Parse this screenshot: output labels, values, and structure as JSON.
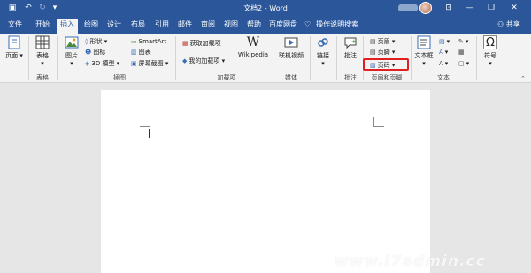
{
  "window": {
    "title": "文档2 - Word",
    "share_label": "共享"
  },
  "tabs": [
    "文件",
    "开始",
    "插入",
    "绘图",
    "设计",
    "布局",
    "引用",
    "邮件",
    "审阅",
    "视图",
    "帮助",
    "百度网盘"
  ],
  "active_tab": "插入",
  "tell_me": "操作说明搜索",
  "ribbon": {
    "pages": {
      "btn": "页面"
    },
    "tables": {
      "btn": "表格",
      "group": "表格"
    },
    "illustrations": {
      "group": "插图",
      "picture": "图片",
      "shapes": "形状",
      "icons": "图标",
      "model3d": "3D 模型",
      "smartart": "SmartArt",
      "chart": "图表",
      "screenshot": "屏幕截图"
    },
    "addins": {
      "group": "加载项",
      "get": "获取加载项",
      "my": "我的加载项",
      "wikipedia": "Wikipedia",
      "wiki_glyph": "W"
    },
    "media": {
      "group": "媒体",
      "video": "联机视频"
    },
    "links": {
      "btn": "链接"
    },
    "comments": {
      "group": "批注",
      "btn": "批注"
    },
    "header_footer": {
      "group": "页眉和页脚",
      "header": "页眉",
      "footer": "页脚",
      "page_number": "页码"
    },
    "text": {
      "group": "文本",
      "textbox": "文本框"
    },
    "symbols": {
      "btn": "符号",
      "omega": "Ω"
    }
  },
  "watermark": "www.I7admin.cc",
  "colors": {
    "accent": "#2b579a",
    "highlight": "#e02020"
  }
}
